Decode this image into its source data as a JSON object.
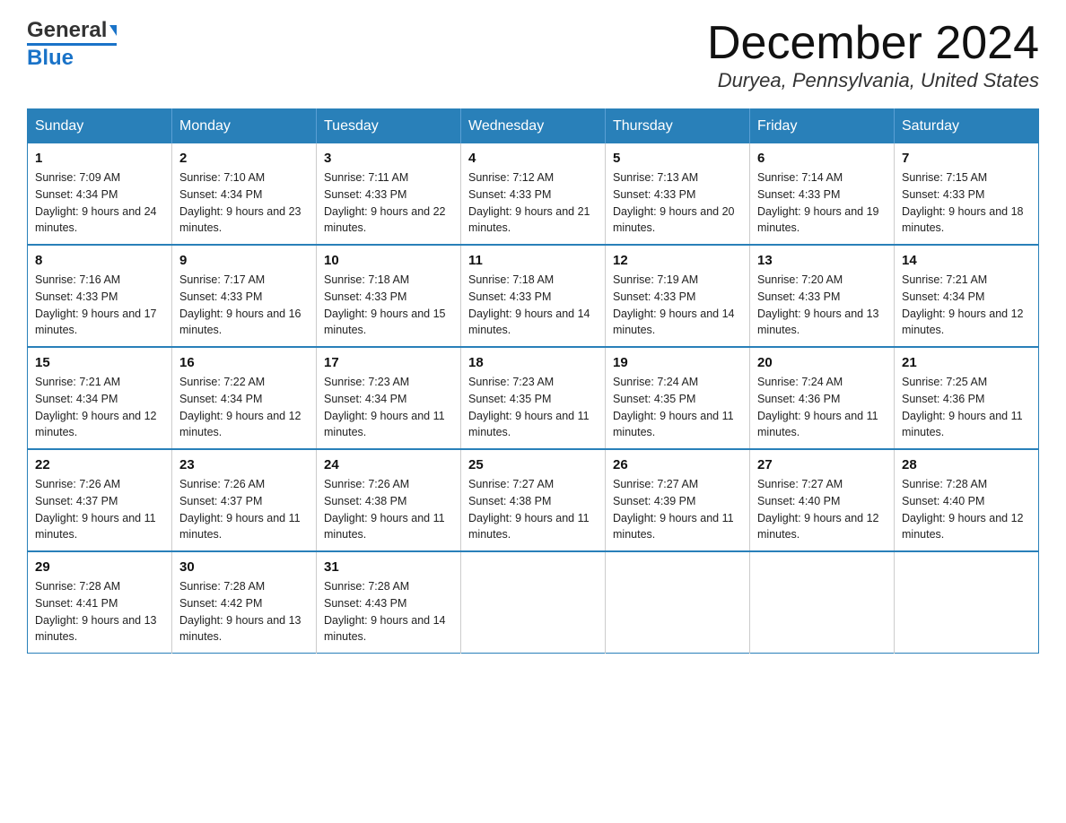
{
  "header": {
    "month_title": "December 2024",
    "location": "Duryea, Pennsylvania, United States",
    "logo_general": "General",
    "logo_blue": "Blue"
  },
  "days_of_week": [
    "Sunday",
    "Monday",
    "Tuesday",
    "Wednesday",
    "Thursday",
    "Friday",
    "Saturday"
  ],
  "weeks": [
    [
      {
        "day": "1",
        "sunrise": "Sunrise: 7:09 AM",
        "sunset": "Sunset: 4:34 PM",
        "daylight": "Daylight: 9 hours and 24 minutes."
      },
      {
        "day": "2",
        "sunrise": "Sunrise: 7:10 AM",
        "sunset": "Sunset: 4:34 PM",
        "daylight": "Daylight: 9 hours and 23 minutes."
      },
      {
        "day": "3",
        "sunrise": "Sunrise: 7:11 AM",
        "sunset": "Sunset: 4:33 PM",
        "daylight": "Daylight: 9 hours and 22 minutes."
      },
      {
        "day": "4",
        "sunrise": "Sunrise: 7:12 AM",
        "sunset": "Sunset: 4:33 PM",
        "daylight": "Daylight: 9 hours and 21 minutes."
      },
      {
        "day": "5",
        "sunrise": "Sunrise: 7:13 AM",
        "sunset": "Sunset: 4:33 PM",
        "daylight": "Daylight: 9 hours and 20 minutes."
      },
      {
        "day": "6",
        "sunrise": "Sunrise: 7:14 AM",
        "sunset": "Sunset: 4:33 PM",
        "daylight": "Daylight: 9 hours and 19 minutes."
      },
      {
        "day": "7",
        "sunrise": "Sunrise: 7:15 AM",
        "sunset": "Sunset: 4:33 PM",
        "daylight": "Daylight: 9 hours and 18 minutes."
      }
    ],
    [
      {
        "day": "8",
        "sunrise": "Sunrise: 7:16 AM",
        "sunset": "Sunset: 4:33 PM",
        "daylight": "Daylight: 9 hours and 17 minutes."
      },
      {
        "day": "9",
        "sunrise": "Sunrise: 7:17 AM",
        "sunset": "Sunset: 4:33 PM",
        "daylight": "Daylight: 9 hours and 16 minutes."
      },
      {
        "day": "10",
        "sunrise": "Sunrise: 7:18 AM",
        "sunset": "Sunset: 4:33 PM",
        "daylight": "Daylight: 9 hours and 15 minutes."
      },
      {
        "day": "11",
        "sunrise": "Sunrise: 7:18 AM",
        "sunset": "Sunset: 4:33 PM",
        "daylight": "Daylight: 9 hours and 14 minutes."
      },
      {
        "day": "12",
        "sunrise": "Sunrise: 7:19 AM",
        "sunset": "Sunset: 4:33 PM",
        "daylight": "Daylight: 9 hours and 14 minutes."
      },
      {
        "day": "13",
        "sunrise": "Sunrise: 7:20 AM",
        "sunset": "Sunset: 4:33 PM",
        "daylight": "Daylight: 9 hours and 13 minutes."
      },
      {
        "day": "14",
        "sunrise": "Sunrise: 7:21 AM",
        "sunset": "Sunset: 4:34 PM",
        "daylight": "Daylight: 9 hours and 12 minutes."
      }
    ],
    [
      {
        "day": "15",
        "sunrise": "Sunrise: 7:21 AM",
        "sunset": "Sunset: 4:34 PM",
        "daylight": "Daylight: 9 hours and 12 minutes."
      },
      {
        "day": "16",
        "sunrise": "Sunrise: 7:22 AM",
        "sunset": "Sunset: 4:34 PM",
        "daylight": "Daylight: 9 hours and 12 minutes."
      },
      {
        "day": "17",
        "sunrise": "Sunrise: 7:23 AM",
        "sunset": "Sunset: 4:34 PM",
        "daylight": "Daylight: 9 hours and 11 minutes."
      },
      {
        "day": "18",
        "sunrise": "Sunrise: 7:23 AM",
        "sunset": "Sunset: 4:35 PM",
        "daylight": "Daylight: 9 hours and 11 minutes."
      },
      {
        "day": "19",
        "sunrise": "Sunrise: 7:24 AM",
        "sunset": "Sunset: 4:35 PM",
        "daylight": "Daylight: 9 hours and 11 minutes."
      },
      {
        "day": "20",
        "sunrise": "Sunrise: 7:24 AM",
        "sunset": "Sunset: 4:36 PM",
        "daylight": "Daylight: 9 hours and 11 minutes."
      },
      {
        "day": "21",
        "sunrise": "Sunrise: 7:25 AM",
        "sunset": "Sunset: 4:36 PM",
        "daylight": "Daylight: 9 hours and 11 minutes."
      }
    ],
    [
      {
        "day": "22",
        "sunrise": "Sunrise: 7:26 AM",
        "sunset": "Sunset: 4:37 PM",
        "daylight": "Daylight: 9 hours and 11 minutes."
      },
      {
        "day": "23",
        "sunrise": "Sunrise: 7:26 AM",
        "sunset": "Sunset: 4:37 PM",
        "daylight": "Daylight: 9 hours and 11 minutes."
      },
      {
        "day": "24",
        "sunrise": "Sunrise: 7:26 AM",
        "sunset": "Sunset: 4:38 PM",
        "daylight": "Daylight: 9 hours and 11 minutes."
      },
      {
        "day": "25",
        "sunrise": "Sunrise: 7:27 AM",
        "sunset": "Sunset: 4:38 PM",
        "daylight": "Daylight: 9 hours and 11 minutes."
      },
      {
        "day": "26",
        "sunrise": "Sunrise: 7:27 AM",
        "sunset": "Sunset: 4:39 PM",
        "daylight": "Daylight: 9 hours and 11 minutes."
      },
      {
        "day": "27",
        "sunrise": "Sunrise: 7:27 AM",
        "sunset": "Sunset: 4:40 PM",
        "daylight": "Daylight: 9 hours and 12 minutes."
      },
      {
        "day": "28",
        "sunrise": "Sunrise: 7:28 AM",
        "sunset": "Sunset: 4:40 PM",
        "daylight": "Daylight: 9 hours and 12 minutes."
      }
    ],
    [
      {
        "day": "29",
        "sunrise": "Sunrise: 7:28 AM",
        "sunset": "Sunset: 4:41 PM",
        "daylight": "Daylight: 9 hours and 13 minutes."
      },
      {
        "day": "30",
        "sunrise": "Sunrise: 7:28 AM",
        "sunset": "Sunset: 4:42 PM",
        "daylight": "Daylight: 9 hours and 13 minutes."
      },
      {
        "day": "31",
        "sunrise": "Sunrise: 7:28 AM",
        "sunset": "Sunset: 4:43 PM",
        "daylight": "Daylight: 9 hours and 14 minutes."
      },
      null,
      null,
      null,
      null
    ]
  ]
}
